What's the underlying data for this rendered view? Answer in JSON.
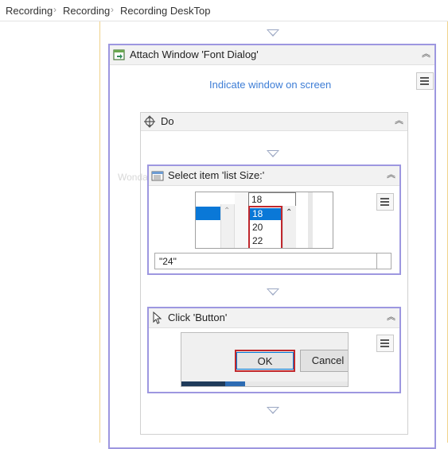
{
  "breadcrumb": [
    "Recording",
    "Recording",
    "Recording DeskTop"
  ],
  "attach_window": {
    "title": "Attach Window 'Font Dialog'",
    "indicate_link": "Indicate window on screen"
  },
  "do_sequence": {
    "title": "Do"
  },
  "select_item": {
    "title": "Select item 'list  Size:'",
    "ghost_text": "Wonda",
    "list_top_value": "18",
    "list_items": [
      "18",
      "20",
      "22"
    ],
    "input_value": "\"24\""
  },
  "click_button": {
    "title": "Click 'Button'",
    "ok_label": "OK",
    "cancel_label": "Cancel"
  },
  "colors": {
    "selection_border": "#9d97e0",
    "link": "#3d7dd6",
    "list_highlight": "#0a78d7",
    "accent_border": "#c0282d"
  },
  "icons": {
    "breadcrumb_separator": "chevron-right-icon",
    "attach_window": "attach-window-icon",
    "do": "sequence-icon",
    "select_item": "select-item-icon",
    "click": "cursor-icon",
    "collapse": "double-chevron-up-icon",
    "menu": "hamburger-icon",
    "drop_target": "drop-triangle-icon"
  }
}
